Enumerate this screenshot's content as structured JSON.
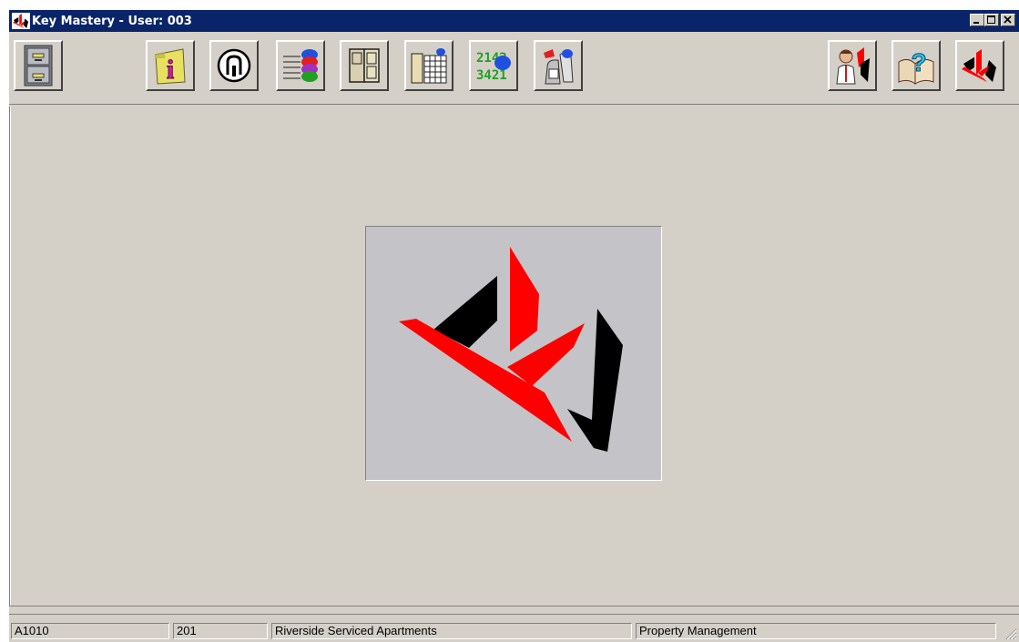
{
  "window": {
    "title": "Key Mastery - User: 003",
    "controls": [
      "minimize",
      "maximize",
      "close"
    ]
  },
  "toolbar": {
    "left_buttons": [
      {
        "name": "file-cabinet-button",
        "icon": "file-cabinet-icon"
      },
      {
        "name": "info-button",
        "icon": "info-icon"
      },
      {
        "name": "key-cylinder-button",
        "icon": "key-cylinder-icon"
      },
      {
        "name": "key-list-button",
        "icon": "key-list-icon"
      },
      {
        "name": "doors-button",
        "icon": "doors-icon"
      },
      {
        "name": "door-grid-button",
        "icon": "door-grid-icon"
      },
      {
        "name": "key-codes-button",
        "icon": "key-codes-icon"
      },
      {
        "name": "key-issue-button",
        "icon": "key-issue-icon"
      }
    ],
    "right_buttons": [
      {
        "name": "user-button",
        "icon": "person-icon"
      },
      {
        "name": "help-button",
        "icon": "help-book-icon"
      },
      {
        "name": "about-button",
        "icon": "app-logo-icon"
      }
    ],
    "key_codes_text": [
      "2142",
      "3421"
    ]
  },
  "colors": {
    "title_bar": "#0a246a",
    "face": "#d4d0c8",
    "logo_red": "#ff0000",
    "logo_black": "#000000"
  },
  "statusbar": {
    "panels": [
      {
        "name": "status-code",
        "text": "A1010"
      },
      {
        "name": "status-number",
        "text": "201"
      },
      {
        "name": "status-property",
        "text": "Riverside Serviced Apartments"
      },
      {
        "name": "status-module",
        "text": "Property Management"
      }
    ]
  }
}
